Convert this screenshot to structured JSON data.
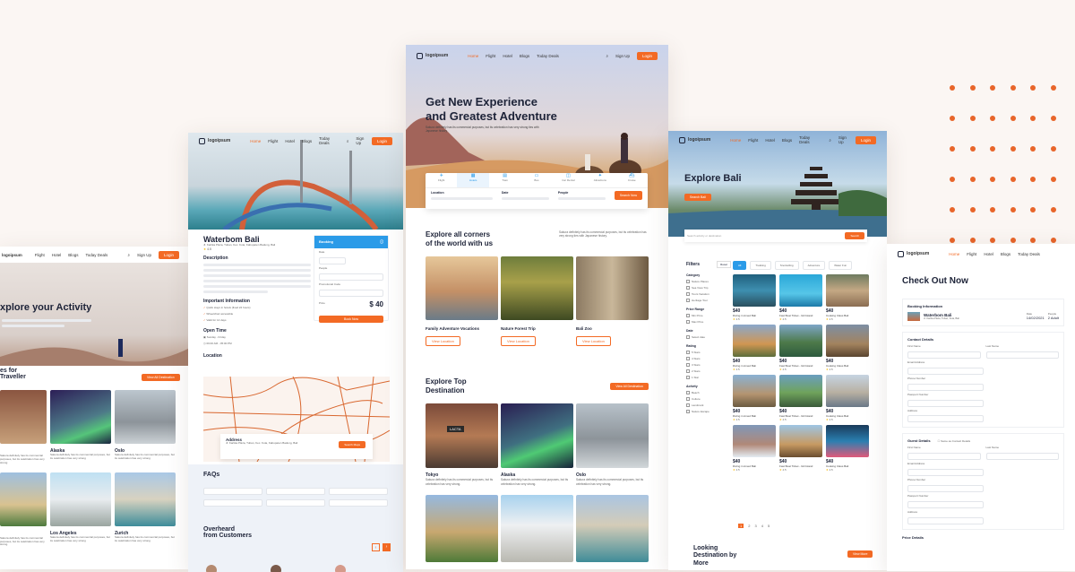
{
  "nav": {
    "logo": "logoipsum",
    "items": [
      "Home",
      "Flight",
      "Hotel",
      "Blogs",
      "Today Deals"
    ],
    "signup": "Sign Up",
    "login": "Login"
  },
  "left_panel": {
    "hero_title": "xplore your Activity",
    "section_title": "es for\nTraveller",
    "view_all": "View All Destination",
    "cards": [
      {
        "title": "",
        "desc": "Sakura definitely has its commercial purposes, but its celebration has very strong"
      },
      {
        "title": "Alaska",
        "desc": "Sakura definitely has its commercial purposes, but its celebration has very strong"
      },
      {
        "title": "Oslo",
        "desc": "Sakura definitely has its commercial purposes, but its celebration has very strong"
      },
      {
        "title": "",
        "desc": "Sakura definitely has its commercial purposes, but its celebration has very strong"
      },
      {
        "title": "Los Angeles",
        "desc": "Sakura definitely has its commercial purposes, but its celebration has very strong"
      },
      {
        "title": "Zurich",
        "desc": "Sakura definitely has its commercial purposes, but its celebration has very strong"
      }
    ]
  },
  "hotel_panel": {
    "title": "Waterbom Bali",
    "address": "Jl. Kartika Plaza, Tuban, Kec. Kuta, Kabupaten Badung, Bali",
    "rating": "4.5",
    "description_title": "Description",
    "important_title": "Important Information",
    "important_items": [
      "Quick stays in hotels (fixed 24 hours)",
      "Wheelchair accessible",
      "Valid for 14 days"
    ],
    "open_title": "Open Time",
    "open_items": [
      "Sunday - Friday",
      "09:00 AM - 05:00 PM"
    ],
    "location_title": "Location",
    "address_label": "Address",
    "route_btn": "Search Maps",
    "faq_title": "FAQs",
    "overheard_title": "Overheard\nfrom Customers",
    "booking": {
      "title": "Booking",
      "date_label": "Date",
      "people_label": "People",
      "promo_label": "Promotional Code",
      "price_label": "Price",
      "price": "$ 40",
      "button": "Book Now"
    }
  },
  "center_panel": {
    "hero_title": "Get New Experience\nand Greatest Adventure",
    "hero_desc": "Sakura definitely has its commercial purposes, but its celebration has very strong ties with Japanese history.",
    "tabs": [
      "Flight",
      "Hotels",
      "Train",
      "Bus",
      "Car Rental",
      "Attractions",
      "Cruise"
    ],
    "search_fields": [
      "Location",
      "Date",
      "People"
    ],
    "search_btn": "Search Now",
    "explore_title": "Explore all corners\nof the world with us",
    "explore_desc": "Sakura definitely has its commercial purposes, but its celebration has very strong ties with Japanese history.",
    "categories": [
      "Family Adventure Vocations",
      "Nature Forest Trip",
      "Bali Zoo"
    ],
    "view_location": "View Location",
    "top_title": "Explore Top\nDestination",
    "view_all": "View All Destination",
    "destinations": [
      {
        "title": "Tokyo",
        "desc": "Sakura definitely has its commercial purposes, but its celebration has very strong."
      },
      {
        "title": "Alaska",
        "desc": "Sakura definitely has its commercial purposes, but its celebration has very strong."
      },
      {
        "title": "Oslo",
        "desc": "Sakura definitely has its commercial purposes, but its celebration has very strong."
      }
    ],
    "sign_lacta": "LACTA"
  },
  "bali_panel": {
    "hero_title": "Explore Bali",
    "hero_btn": "Search Bali",
    "search_placeholder": "Search activity or destination",
    "search_btn": "Search",
    "filters_title": "Filters",
    "reset": "Reset",
    "filter_tabs": [
      "All",
      "Trekking",
      "Snorkelling",
      "Adventure",
      "Water Fun"
    ],
    "filter_groups": [
      {
        "title": "Category",
        "items": [
          "Nature Places",
          "Sea View Trip",
          "Tours Vacation",
          "Heritage Tour"
        ]
      },
      {
        "title": "Price Range",
        "items": [
          "Min Price",
          "Max Price"
        ]
      },
      {
        "title": "Date",
        "items": [
          "Select date"
        ]
      },
      {
        "title": "Rating",
        "items": [
          "5 Stars",
          "4 Stars",
          "3 Stars",
          "2 Stars",
          "1 Star"
        ]
      },
      {
        "title": "Activity",
        "items": [
          "Beach",
          "Culture",
          "Landmark",
          "Nature Escape"
        ]
      }
    ],
    "grid_items": [
      {
        "price": "$40",
        "name": "Diving in Amed Bali",
        "rating": "4.5"
      },
      {
        "price": "$40",
        "name": "Fast Boat Ticket - Gili Island",
        "rating": "4.5"
      },
      {
        "price": "$40",
        "name": "Cooking Class Bali",
        "rating": "4.5"
      },
      {
        "price": "$40",
        "name": "Diving in Amed Bali",
        "rating": "4.5"
      },
      {
        "price": "$40",
        "name": "Fast Boat Ticket - Gili Island",
        "rating": "4.5"
      },
      {
        "price": "$40",
        "name": "Cooking Class Bali",
        "rating": "4.5"
      },
      {
        "price": "$40",
        "name": "Diving in Amed Bali",
        "rating": "4.5"
      },
      {
        "price": "$40",
        "name": "Fast Boat Ticket - Gili Island",
        "rating": "4.5"
      },
      {
        "price": "$40",
        "name": "Cooking Class Bali",
        "rating": "4.5"
      },
      {
        "price": "$40",
        "name": "Diving in Amed Bali",
        "rating": "4.5"
      },
      {
        "price": "$40",
        "name": "Fast Boat Ticket - Gili Island",
        "rating": "4.5"
      },
      {
        "price": "$40",
        "name": "Cooking Class Bali",
        "rating": "4.5"
      }
    ],
    "pages": [
      "1",
      "2",
      "3",
      "4",
      "5"
    ],
    "looking_title": "Looking\nDestination by\nMore",
    "view_more": "View More"
  },
  "checkout_panel": {
    "title": "Check Out Now",
    "booking_info": "Booking Information",
    "item_name": "Waterbom Bali",
    "item_addr": "Jl. Kartika Plaza, Tuban, Kuta, Bali",
    "date_label": "Date",
    "date_value": "14/02/2021",
    "people_label": "People",
    "people_value": "2 Adult",
    "contact_title": "Contact Details",
    "first_name": "First Name",
    "last_name": "Last Name",
    "email": "Email Address",
    "phone": "Phone Number",
    "passport": "Passport Number",
    "address": "Address",
    "guest_title": "Guest Details",
    "same_contact": "Same as Contact Details",
    "price_title": "Price Details"
  },
  "colors": {
    "accent": "#f36a24",
    "background": "#fbf6f3",
    "navy": "#1d2338"
  }
}
